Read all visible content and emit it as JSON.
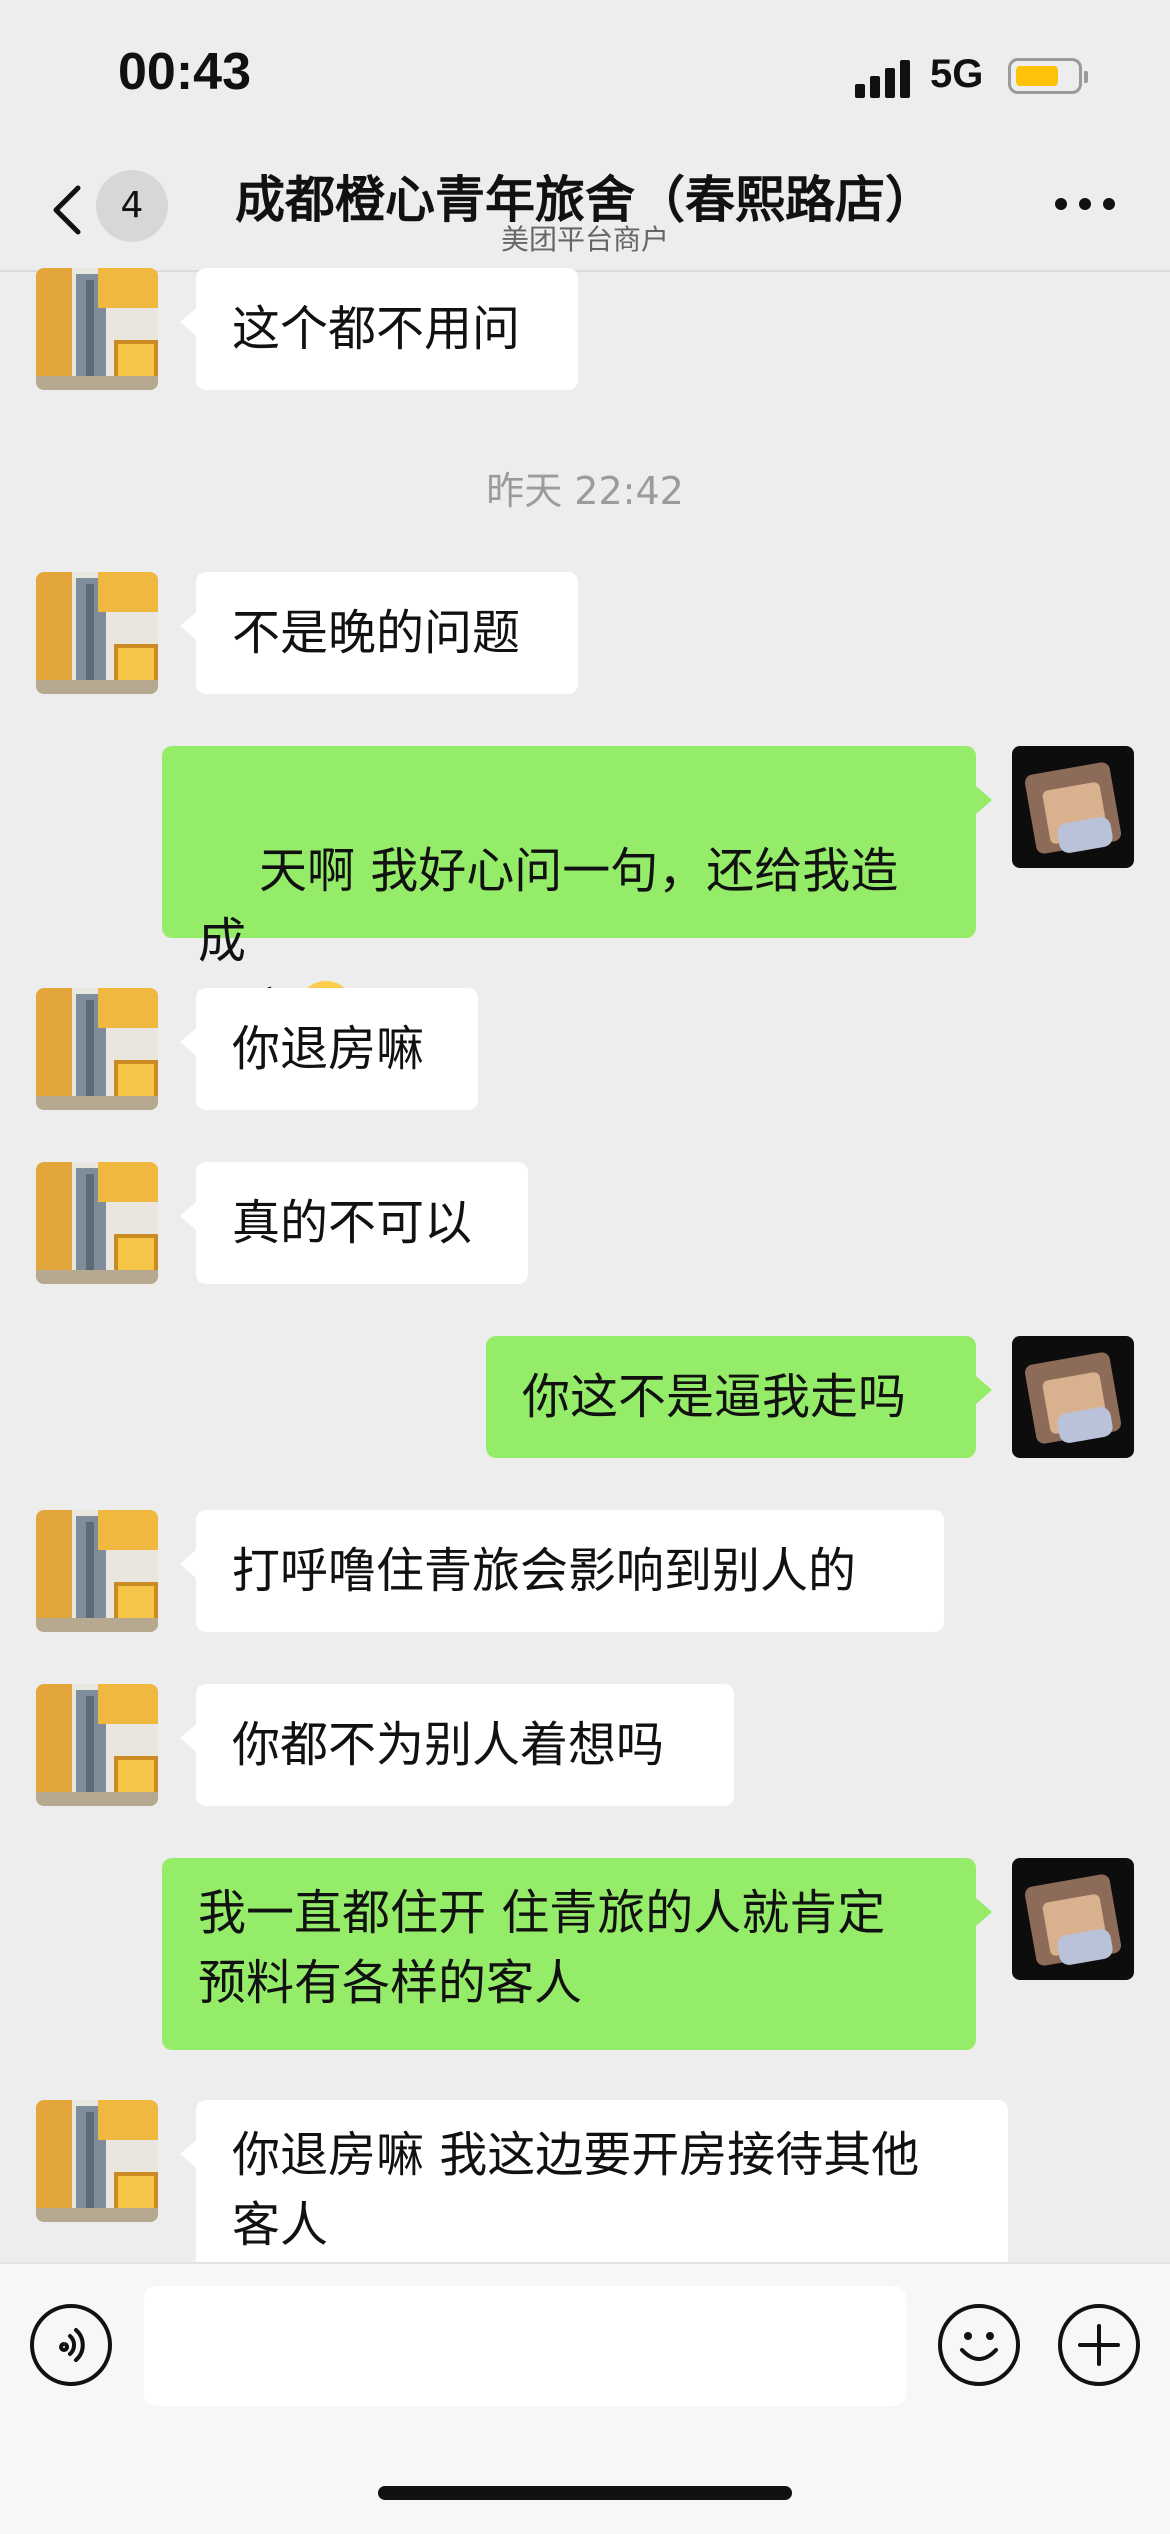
{
  "status_bar": {
    "time": "00:43",
    "network": "5G",
    "battery_level": 0.65
  },
  "header": {
    "back_badge": "4",
    "title": "成都橙心青年旅舍（春熙路店）",
    "subtitle": "美团平台商户"
  },
  "timestamp": "昨天 22:42",
  "messages": [
    {
      "from": "hotel",
      "text": "这个都不用问"
    },
    {
      "from": "hotel",
      "text": "不是晚的问题"
    },
    {
      "from": "me",
      "text": "天啊 我好心问一句，还给我造成\n退房"
    },
    {
      "from": "hotel",
      "text": "你退房嘛"
    },
    {
      "from": "hotel",
      "text": "真的不可以"
    },
    {
      "from": "me",
      "text": "你这不是逼我走吗"
    },
    {
      "from": "hotel",
      "text": "打呼噜住青旅会影响到别人的"
    },
    {
      "from": "hotel",
      "text": "你都不为别人着想吗"
    },
    {
      "from": "me",
      "text": "我一直都住开 住青旅的人就肯定\n预料有各样的客人"
    },
    {
      "from": "hotel",
      "text": "你退房嘛 我这边要开房接待其他\n客人"
    }
  ],
  "input_bar": {
    "value": "",
    "icons": [
      "voice-icon",
      "emoji-icon",
      "plus-icon"
    ]
  }
}
